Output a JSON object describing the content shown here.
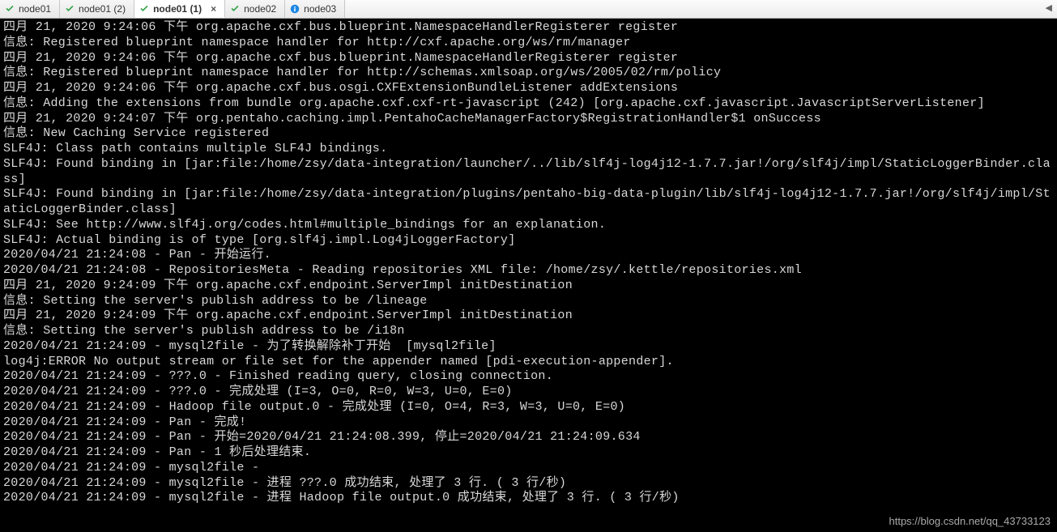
{
  "tabs": [
    {
      "label": "node01",
      "icon": "check",
      "active": false
    },
    {
      "label": "node01 (2)",
      "icon": "check",
      "active": false
    },
    {
      "label": "node01 (1)",
      "icon": "check",
      "active": true
    },
    {
      "label": "node02",
      "icon": "check",
      "active": false
    },
    {
      "label": "node03",
      "icon": "info",
      "active": false
    }
  ],
  "close_glyph": "×",
  "chevron_glyph": "◀",
  "terminal_lines": [
    "四月 21, 2020 9:24:06 下午 org.apache.cxf.bus.blueprint.NamespaceHandlerRegisterer register",
    "信息: Registered blueprint namespace handler for http://cxf.apache.org/ws/rm/manager",
    "四月 21, 2020 9:24:06 下午 org.apache.cxf.bus.blueprint.NamespaceHandlerRegisterer register",
    "信息: Registered blueprint namespace handler for http://schemas.xmlsoap.org/ws/2005/02/rm/policy",
    "四月 21, 2020 9:24:06 下午 org.apache.cxf.bus.osgi.CXFExtensionBundleListener addExtensions",
    "信息: Adding the extensions from bundle org.apache.cxf.cxf-rt-javascript (242) [org.apache.cxf.javascript.JavascriptServerListener]",
    "四月 21, 2020 9:24:07 下午 org.pentaho.caching.impl.PentahoCacheManagerFactory$RegistrationHandler$1 onSuccess",
    "信息: New Caching Service registered",
    "SLF4J: Class path contains multiple SLF4J bindings.",
    "SLF4J: Found binding in [jar:file:/home/zsy/data-integration/launcher/../lib/slf4j-log4j12-1.7.7.jar!/org/slf4j/impl/StaticLoggerBinder.class]",
    "SLF4J: Found binding in [jar:file:/home/zsy/data-integration/plugins/pentaho-big-data-plugin/lib/slf4j-log4j12-1.7.7.jar!/org/slf4j/impl/StaticLoggerBinder.class]",
    "SLF4J: See http://www.slf4j.org/codes.html#multiple_bindings for an explanation.",
    "SLF4J: Actual binding is of type [org.slf4j.impl.Log4jLoggerFactory]",
    "2020/04/21 21:24:08 - Pan - 开始运行.",
    "2020/04/21 21:24:08 - RepositoriesMeta - Reading repositories XML file: /home/zsy/.kettle/repositories.xml",
    "四月 21, 2020 9:24:09 下午 org.apache.cxf.endpoint.ServerImpl initDestination",
    "信息: Setting the server's publish address to be /lineage",
    "四月 21, 2020 9:24:09 下午 org.apache.cxf.endpoint.ServerImpl initDestination",
    "信息: Setting the server's publish address to be /i18n",
    "2020/04/21 21:24:09 - mysql2file - 为了转换解除补丁开始  [mysql2file]",
    "log4j:ERROR No output stream or file set for the appender named [pdi-execution-appender].",
    "2020/04/21 21:24:09 - ???.0 - Finished reading query, closing connection.",
    "2020/04/21 21:24:09 - ???.0 - 完成处理 (I=3, O=0, R=0, W=3, U=0, E=0)",
    "2020/04/21 21:24:09 - Hadoop file output.0 - 完成处理 (I=0, O=4, R=3, W=3, U=0, E=0)",
    "2020/04/21 21:24:09 - Pan - 完成!",
    "2020/04/21 21:24:09 - Pan - 开始=2020/04/21 21:24:08.399, 停止=2020/04/21 21:24:09.634",
    "2020/04/21 21:24:09 - Pan - 1 秒后处理结束.",
    "2020/04/21 21:24:09 - mysql2file -",
    "2020/04/21 21:24:09 - mysql2file - 进程 ???.0 成功结束, 处理了 3 行. ( 3 行/秒)",
    "2020/04/21 21:24:09 - mysql2file - 进程 Hadoop file output.0 成功结束, 处理了 3 行. ( 3 行/秒)"
  ],
  "watermark": "https://blog.csdn.net/qq_43733123"
}
